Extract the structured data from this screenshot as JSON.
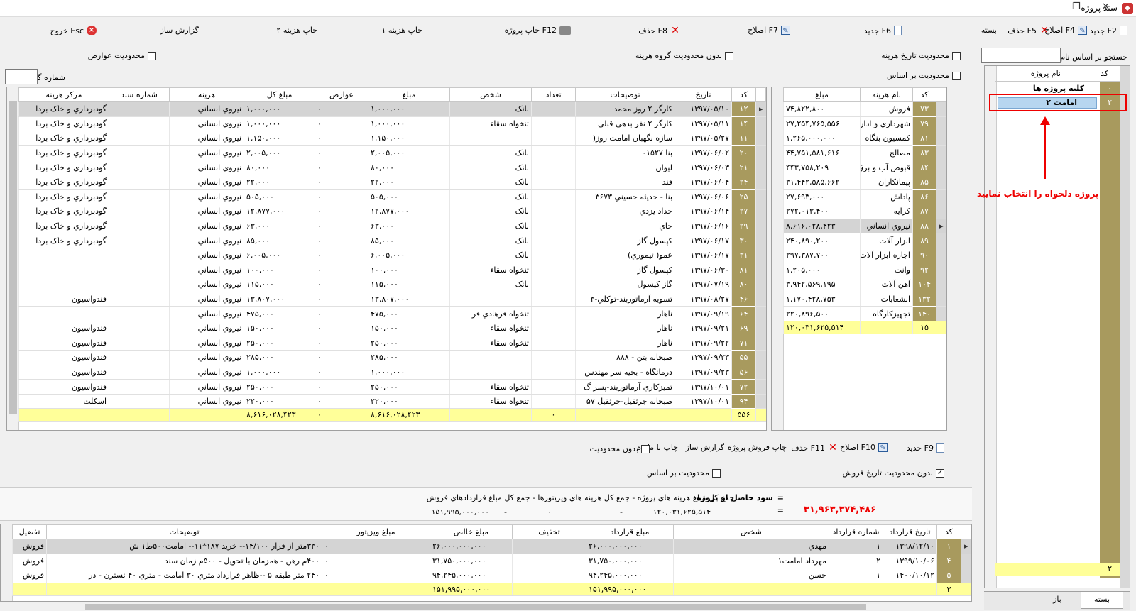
{
  "window": {
    "title": "سند پروژه",
    "max_icon": "❐",
    "close_icon": "✕"
  },
  "toolbar": {
    "new": "جديد F6",
    "edit": "اصلاح F7",
    "delete": "حذف F8",
    "print_project": "چاپ پروژه F12",
    "print_cost1": "چاپ هزينه ۱",
    "print_cost2": "چاپ هزينه ۲",
    "report_builder": "گزارش ساز",
    "exit": "خروج Esc"
  },
  "filters": {
    "cost_date_limit": "محدوديت تاريخ هزينه",
    "no_group_limit": "بدون محدوديت گروه هزينه",
    "duty_limit": "محدوديت عوارض",
    "basis_limit": "محدوديت بر اساس",
    "report_no": "شماره گزارش"
  },
  "right_panel": {
    "new": "جديد F2",
    "edit": "اصلاح F4",
    "delete": "حذف F5",
    "close": "بسته",
    "search_label": "جستجو بر اساس نام",
    "col_code": "کد",
    "col_name": "نام پروژه",
    "rows": [
      {
        "code": "۰",
        "name": "کليه پروژه ها"
      },
      {
        "code": "۲",
        "name": "امامت ۲"
      }
    ],
    "count": "۲",
    "tab_closed": "بسته",
    "tab_open": "باز",
    "annotation": "پروژه دلخواه را انتخاب نماييد"
  },
  "cost_group": {
    "cols": [
      "کد",
      "نام هزينه",
      "مبلغ"
    ],
    "rows": [
      [
        "۷۳",
        "فروش",
        "۷۴,۸۲۲,۸۰۰"
      ],
      [
        "۷۹",
        "شهرداري و ادار",
        "۲۷,۲۵۴,۷۶۵,۵۵۶"
      ],
      [
        "۸۱",
        "کمسيون بنگاه",
        "۱,۲۶۵,۰۰۰,۰۰۰"
      ],
      [
        "۸۳",
        "مصالح",
        "۴۴,۷۵۱,۵۸۱,۶۱۶"
      ],
      [
        "۸۴",
        "قبوض آب و برق",
        "۴۴۳,۷۵۸,۲۰۹"
      ],
      [
        "۸۵",
        "پيمانکاران",
        "۳۱,۴۴۲,۵۸۵,۶۶۲"
      ],
      [
        "۸۶",
        "پاداش",
        "۲۷,۶۹۳,۰۰۰"
      ],
      [
        "۸۷",
        "کرايه",
        "۲۷۲,۰۱۳,۴۰۰"
      ],
      [
        "۸۸",
        "نيروي انساني",
        "۸,۶۱۶,۰۲۸,۴۲۳"
      ],
      [
        "۸۹",
        "ابزار آلات",
        "۲۴۰,۸۹۰,۲۰۰"
      ],
      [
        "۹۰",
        "اجاره ابزار آلات",
        "۲۹۷,۳۸۷,۷۰۰"
      ],
      [
        "۹۲",
        "وانت",
        "۱,۲۰۵,۰۰۰"
      ],
      [
        "۱۰۴",
        "آهن آلات",
        "۳,۹۴۲,۵۶۹,۱۹۵"
      ],
      [
        "۱۳۲",
        "انشعابات",
        "۱,۱۷۰,۴۲۸,۷۵۳"
      ],
      [
        "۱۴۰",
        "تجهيزکارگاه",
        "۲۲۰,۸۹۶,۵۰۰"
      ]
    ],
    "sum_code": "۱۵",
    "sum_amount": "۱۲۰,۰۳۱,۶۲۵,۵۱۴"
  },
  "cost_details": {
    "cols": [
      "کد",
      "تاريخ",
      "توضيحات",
      "تعداد",
      "شخص",
      "مبلغ",
      "عوارض",
      "مبلغ کل",
      "هزينه",
      "شماره سند",
      "مرکز هزينه"
    ],
    "rows": [
      [
        "۱۲",
        "۱۳۹۷/۰۵/۱۰",
        "کارگر ۲ روز محمد",
        "",
        "بانک",
        "۱,۰۰۰,۰۰۰",
        "۰",
        "۱,۰۰۰,۰۰۰",
        "نيروي انساني",
        "",
        "گودبرداري و خاک بردا"
      ],
      [
        "۱۴",
        "۱۳۹۷/۰۵/۱۱",
        "کارگر ۲ نفر بدهي قبلي",
        "",
        "تنخواه سقاء",
        "۱,۰۰۰,۰۰۰",
        "۰",
        "۱,۰۰۰,۰۰۰",
        "نيروي انساني",
        "",
        "گودبرداري و خاک بردا"
      ],
      [
        "۱۱",
        "۱۳۹۷/۰۵/۲۷",
        "سازه نگهبان امامت روز(",
        "",
        "",
        "۱,۱۵۰,۰۰۰",
        "۰",
        "۱,۱۵۰,۰۰۰",
        "نيروي انساني",
        "",
        "گودبرداري و خاک بردا"
      ],
      [
        "۲۰",
        "۱۳۹۷/۰۶/۰۲",
        "بنا ۰۱۵۲۷",
        "",
        "بانک",
        "۲,۰۰۵,۰۰۰",
        "۰",
        "۲,۰۰۵,۰۰۰",
        "نيروي انساني",
        "",
        "گودبرداري و خاک بردا"
      ],
      [
        "۲۱",
        "۱۳۹۷/۰۶/۰۳",
        "ليوان",
        "",
        "بانک",
        "۸۰,۰۰۰",
        "۰",
        "۸۰,۰۰۰",
        "نيروي انساني",
        "",
        "گودبرداري و خاک بردا"
      ],
      [
        "۲۴",
        "۱۳۹۷/۰۶/۰۴",
        "قند",
        "",
        "بانک",
        "۲۲,۰۰۰",
        "۰",
        "۲۲,۰۰۰",
        "نيروي انساني",
        "",
        "گودبرداري و خاک بردا"
      ],
      [
        "۲۵",
        "۱۳۹۷/۰۶/۰۶",
        "بنا - حديثه حسيني ۳۶۷۳",
        "",
        "بانک",
        "۵۰۵,۰۰۰",
        "۰",
        "۵۰۵,۰۰۰",
        "نيروي انساني",
        "",
        "گودبرداري و خاک بردا"
      ],
      [
        "۲۷",
        "۱۳۹۷/۰۶/۱۴",
        "حداد يزدي",
        "",
        "بانک",
        "۱۲,۸۷۷,۰۰۰",
        "۰",
        "۱۲,۸۷۷,۰۰۰",
        "نيروي انساني",
        "",
        "گودبرداري و خاک بردا"
      ],
      [
        "۲۹",
        "۱۳۹۷/۰۶/۱۶",
        "چاي",
        "",
        "بانک",
        "۶۳,۰۰۰",
        "۰",
        "۶۳,۰۰۰",
        "نيروي انساني",
        "",
        "گودبرداري و خاک بردا"
      ],
      [
        "۳۰",
        "۱۳۹۷/۰۶/۱۷",
        "کپسول گاز",
        "",
        "بانک",
        "۸۵,۰۰۰",
        "۰",
        "۸۵,۰۰۰",
        "نيروي انساني",
        "",
        "گودبرداري و خاک بردا"
      ],
      [
        "۳۱",
        "۱۳۹۷/۰۶/۱۷",
        "عمو( تيموري)",
        "",
        "بانک",
        "۶,۰۰۵,۰۰۰",
        "۰",
        "۶,۰۰۵,۰۰۰",
        "نيروي انساني",
        "",
        ""
      ],
      [
        "۸۱",
        "۱۳۹۷/۰۶/۳۰",
        "کپسول گاز",
        "",
        "تنخواه سقاء",
        "۱۰۰,۰۰۰",
        "۰",
        "۱۰۰,۰۰۰",
        "نيروي انساني",
        "",
        ""
      ],
      [
        "۸۰",
        "۱۳۹۷/۰۷/۱۹",
        "گاز کپسول",
        "",
        "بانک",
        "۱۱۵,۰۰۰",
        "۰",
        "۱۱۵,۰۰۰",
        "نيروي انساني",
        "",
        ""
      ],
      [
        "۴۶",
        "۱۳۹۷/۰۸/۲۷",
        "تسويه آرماتوربند-توکلي-۳",
        "",
        "",
        "۱۳,۸۰۷,۰۰۰",
        "۰",
        "۱۳,۸۰۷,۰۰۰",
        "نيروي انساني",
        "",
        "فندواسيون"
      ],
      [
        "۶۴",
        "۱۳۹۷/۰۹/۱۹",
        "ناهار",
        "",
        "تنخواه فرهادي فر",
        "۴۷۵,۰۰۰",
        "۰",
        "۴۷۵,۰۰۰",
        "نيروي انساني",
        "",
        ""
      ],
      [
        "۶۹",
        "۱۳۹۷/۰۹/۲۱",
        "ناهار",
        "",
        "تنخواه سقاء",
        "۱۵۰,۰۰۰",
        "۰",
        "۱۵۰,۰۰۰",
        "نيروي انساني",
        "",
        "فندواسيون"
      ],
      [
        "۷۱",
        "۱۳۹۷/۰۹/۲۲",
        "ناهار",
        "",
        "تنخواه سقاء",
        "۲۵۰,۰۰۰",
        "۰",
        "۲۵۰,۰۰۰",
        "نيروي انساني",
        "",
        "فندواسيون"
      ],
      [
        "۵۵",
        "۱۳۹۷/۰۹/۲۳",
        "صبحانه بتن - ۸۸۸",
        "",
        "",
        "۲۸۵,۰۰۰",
        "۰",
        "۲۸۵,۰۰۰",
        "نيروي انساني",
        "",
        "فندواسيون"
      ],
      [
        "۵۶",
        "۱۳۹۷/۰۹/۲۳",
        "درمانگاه - بخيه سر مهندس",
        "",
        "",
        "۱,۰۰۰,۰۰۰",
        "۰",
        "۱,۰۰۰,۰۰۰",
        "نيروي انساني",
        "",
        "فندواسيون"
      ],
      [
        "۷۲",
        "۱۳۹۷/۱۰/۰۱",
        "تميزکاري آرماتوربند-پسر گ",
        "",
        "تنخواه سقاء",
        "۲۵۰,۰۰۰",
        "۰",
        "۲۵۰,۰۰۰",
        "نيروي انساني",
        "",
        "فندواسيون"
      ],
      [
        "۹۴",
        "۱۳۹۷/۱۰/۰۱",
        "صبحانه جرثقيل-جرثقيل ۵۷",
        "",
        "تنخواه سقاء",
        "۲۲۰,۰۰۰",
        "۰",
        "۲۲۰,۰۰۰",
        "نيروي انساني",
        "",
        "اسکلت"
      ]
    ],
    "sum": [
      "۵۵۶",
      "",
      "",
      "۰",
      "",
      "۸,۶۱۶,۰۲۸,۴۲۳",
      "۰",
      "۸,۶۱۶,۰۲۸,۴۲۳",
      "",
      "",
      ""
    ]
  },
  "sales_toolbar": {
    "new": "جديد F9",
    "edit": "اصلاح F10",
    "delete": "حذف F11",
    "print_sales": "چاپ فروش پروژه",
    "report_builder": "گزارش ساز",
    "print_remain": "چاپ با مانده",
    "no_limit": "بدون محدوديت",
    "no_date_limit": "بدون محدوديت تاريخ فروش",
    "basis_limit": "محدوديت بر اساس"
  },
  "summary": {
    "profit_label": "سود حاصل از پروژه",
    "eq": "=",
    "formula_text": "جمع کل مبلغ هزينه هاي پروژه  -  جمع کل هزينه هاي ويزيتورها  -  جمع کل مبلغ قراردادهاي فروش",
    "profit_value": "۳۱,۹۶۳,۳۷۴,۴۸۶",
    "v_costs": "۱۲۰,۰۳۱,۶۲۵,۵۱۴",
    "v_visitors": "۰",
    "v_sales": "۱۵۱,۹۹۵,۰۰۰,۰۰۰",
    "dash": "-"
  },
  "sales": {
    "cols": [
      "کد",
      "تاريخ قرارداد",
      "شماره قرارداد",
      "شخص",
      "مبلغ قرارداد",
      "تخفيف",
      "مبلغ خالص",
      "مبلغ ويزيتور",
      "توضيحات",
      "تفضيل"
    ],
    "rows": [
      [
        "۱",
        "۱۳۹۸/۱۲/۱۰",
        "۱",
        "مهدي",
        "۲۶,۰۰۰,۰۰۰,۰۰۰",
        "",
        "۲۶,۰۰۰,۰۰۰,۰۰۰",
        "۰",
        "۳۳۰متر از قرار ۱۴/۱۰۰-- خريد ۱۸۷*۱۱-- امامت۵۰۰ط۱ ش",
        "فروش"
      ],
      [
        "۴",
        "۱۳۹۹/۱۰/۰۶",
        "۲",
        "مهرداد امامت۱",
        "۳۱,۷۵۰,۰۰۰,۰۰۰",
        "",
        "۳۱,۷۵۰,۰۰۰,۰۰۰",
        "۰",
        "۴۰۰م رهن - همزمان با تحويل - ۵۰۰م زمان سند",
        "فروش"
      ],
      [
        "۵",
        "۱۴۰۰/۱۰/۱۲",
        "۱",
        "حسن",
        "۹۴,۲۴۵,۰۰۰,۰۰۰",
        "",
        "۹۴,۲۴۵,۰۰۰,۰۰۰",
        "۰",
        "۲۴۰ متر طبقه ۵ --ظاهر قرارداد متري ۳۰ امامت - متري ۴۰ نسترن - در",
        "فروش"
      ]
    ],
    "sum": [
      "۳",
      "",
      "",
      "",
      "۱۵۱,۹۹۵,۰۰۰,۰۰۰",
      "",
      "۱۵۱,۹۹۵,۰۰۰,۰۰۰",
      "",
      "",
      ""
    ]
  }
}
